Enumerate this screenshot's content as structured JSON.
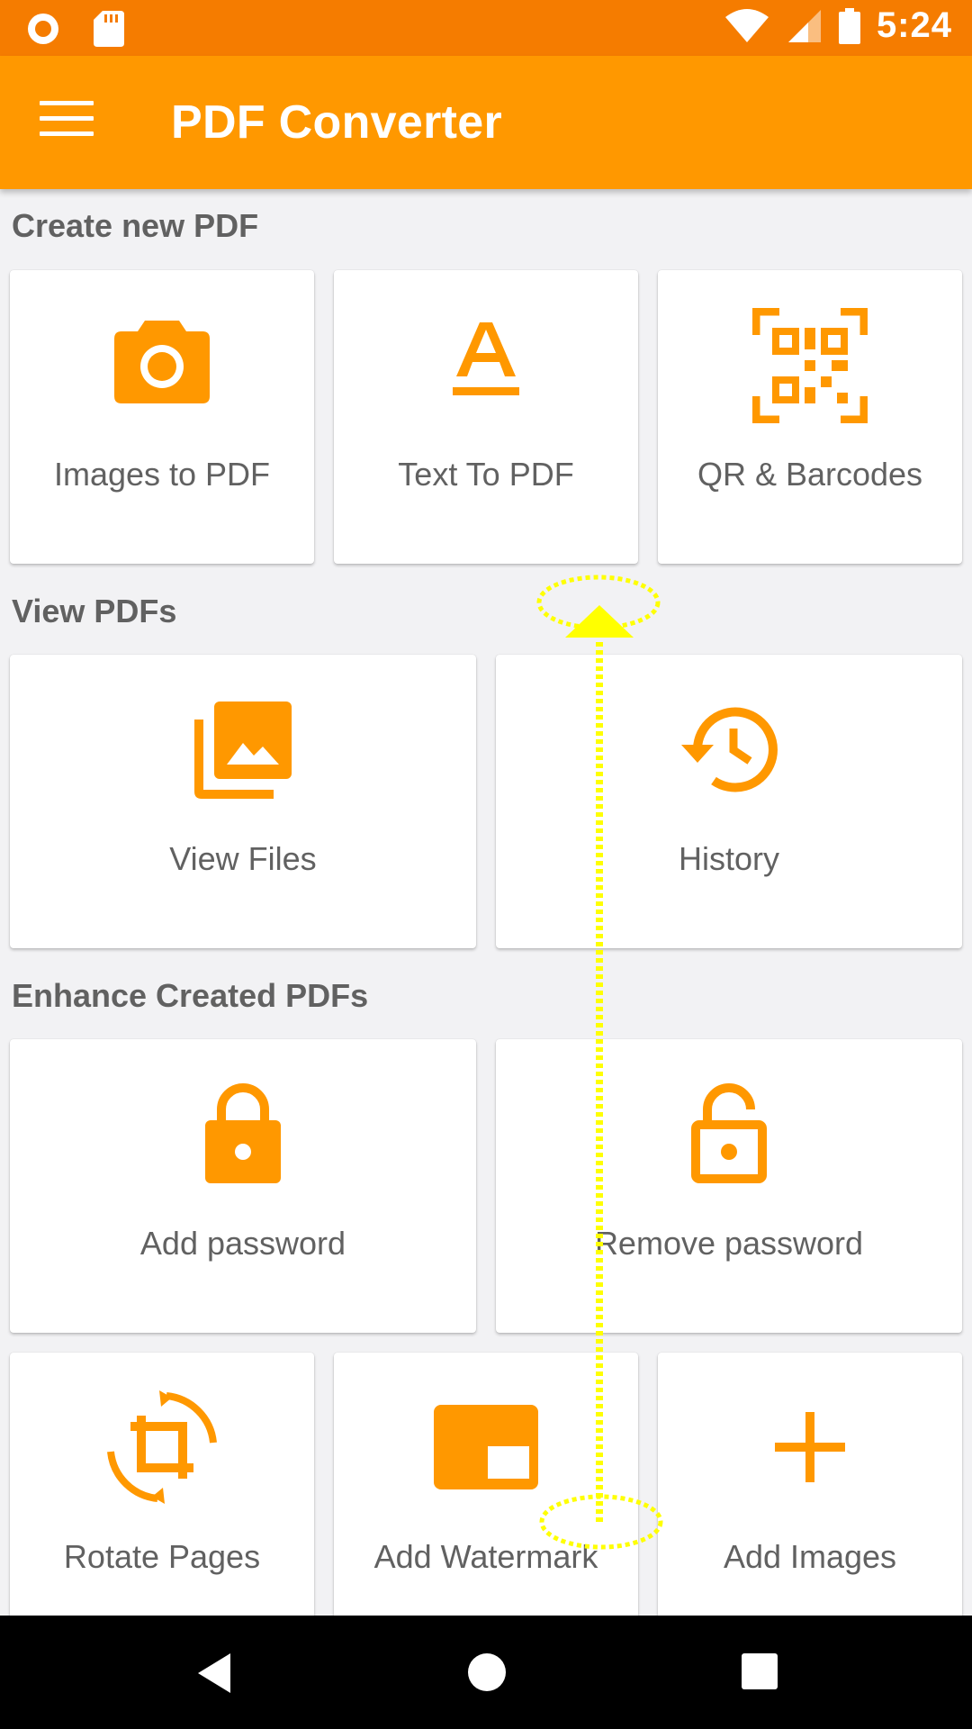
{
  "status_bar": {
    "time": "5:24",
    "left_icons": [
      "recording-icon",
      "sd-card-icon"
    ],
    "right_icons": [
      "wifi-icon",
      "cell-signal-icon",
      "battery-icon"
    ]
  },
  "app_bar": {
    "title": "PDF Converter",
    "menu_icon": "menu-icon"
  },
  "sections": {
    "create": {
      "title": "Create new PDF",
      "items": [
        {
          "label": "Images to PDF",
          "icon": "camera-icon"
        },
        {
          "label": "Text To PDF",
          "icon": "text-format-icon"
        },
        {
          "label": "QR & Barcodes",
          "icon": "qr-code-icon"
        }
      ]
    },
    "view": {
      "title": "View PDFs",
      "items": [
        {
          "label": "View Files",
          "icon": "photo-library-icon"
        },
        {
          "label": "History",
          "icon": "history-icon"
        }
      ]
    },
    "enhance": {
      "title": "Enhance Created PDFs",
      "items": [
        {
          "label": "Add password",
          "icon": "lock-icon"
        },
        {
          "label": "Remove password",
          "icon": "lock-open-icon"
        },
        {
          "label": "Rotate Pages",
          "icon": "crop-rotate-icon"
        },
        {
          "label": "Add Watermark",
          "icon": "watermark-icon"
        },
        {
          "label": "Add Images",
          "icon": "plus-icon"
        }
      ]
    }
  },
  "nav_bar": {
    "buttons": [
      "back-icon",
      "home-icon",
      "recents-icon"
    ]
  },
  "colors": {
    "status_bar": "#f57c00",
    "app_bar": "#ff9800",
    "accent": "#ff9800",
    "text_secondary": "#616161",
    "background": "#f2f2f4",
    "gesture_overlay": "#ffff00"
  },
  "gesture_overlay": {
    "type": "swipe-up"
  }
}
